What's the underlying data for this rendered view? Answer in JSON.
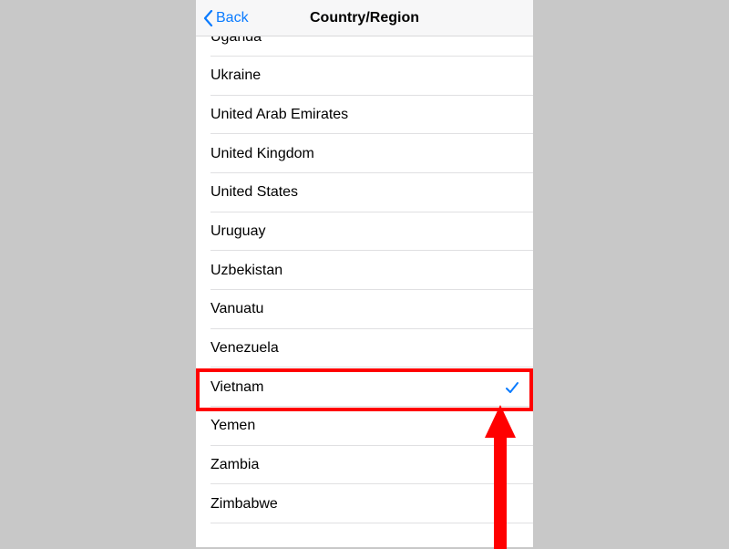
{
  "nav": {
    "back_label": "Back",
    "title": "Country/Region"
  },
  "countries": [
    {
      "label": "Uganda",
      "selected": false
    },
    {
      "label": "Ukraine",
      "selected": false
    },
    {
      "label": "United Arab Emirates",
      "selected": false
    },
    {
      "label": "United Kingdom",
      "selected": false
    },
    {
      "label": "United States",
      "selected": false
    },
    {
      "label": "Uruguay",
      "selected": false
    },
    {
      "label": "Uzbekistan",
      "selected": false
    },
    {
      "label": "Vanuatu",
      "selected": false
    },
    {
      "label": "Venezuela",
      "selected": false
    },
    {
      "label": "Vietnam",
      "selected": true
    },
    {
      "label": "Yemen",
      "selected": false
    },
    {
      "label": "Zambia",
      "selected": false
    },
    {
      "label": "Zimbabwe",
      "selected": false
    }
  ],
  "annotation": {
    "highlight_target_index": 9,
    "arrow_color": "#ff0000"
  }
}
